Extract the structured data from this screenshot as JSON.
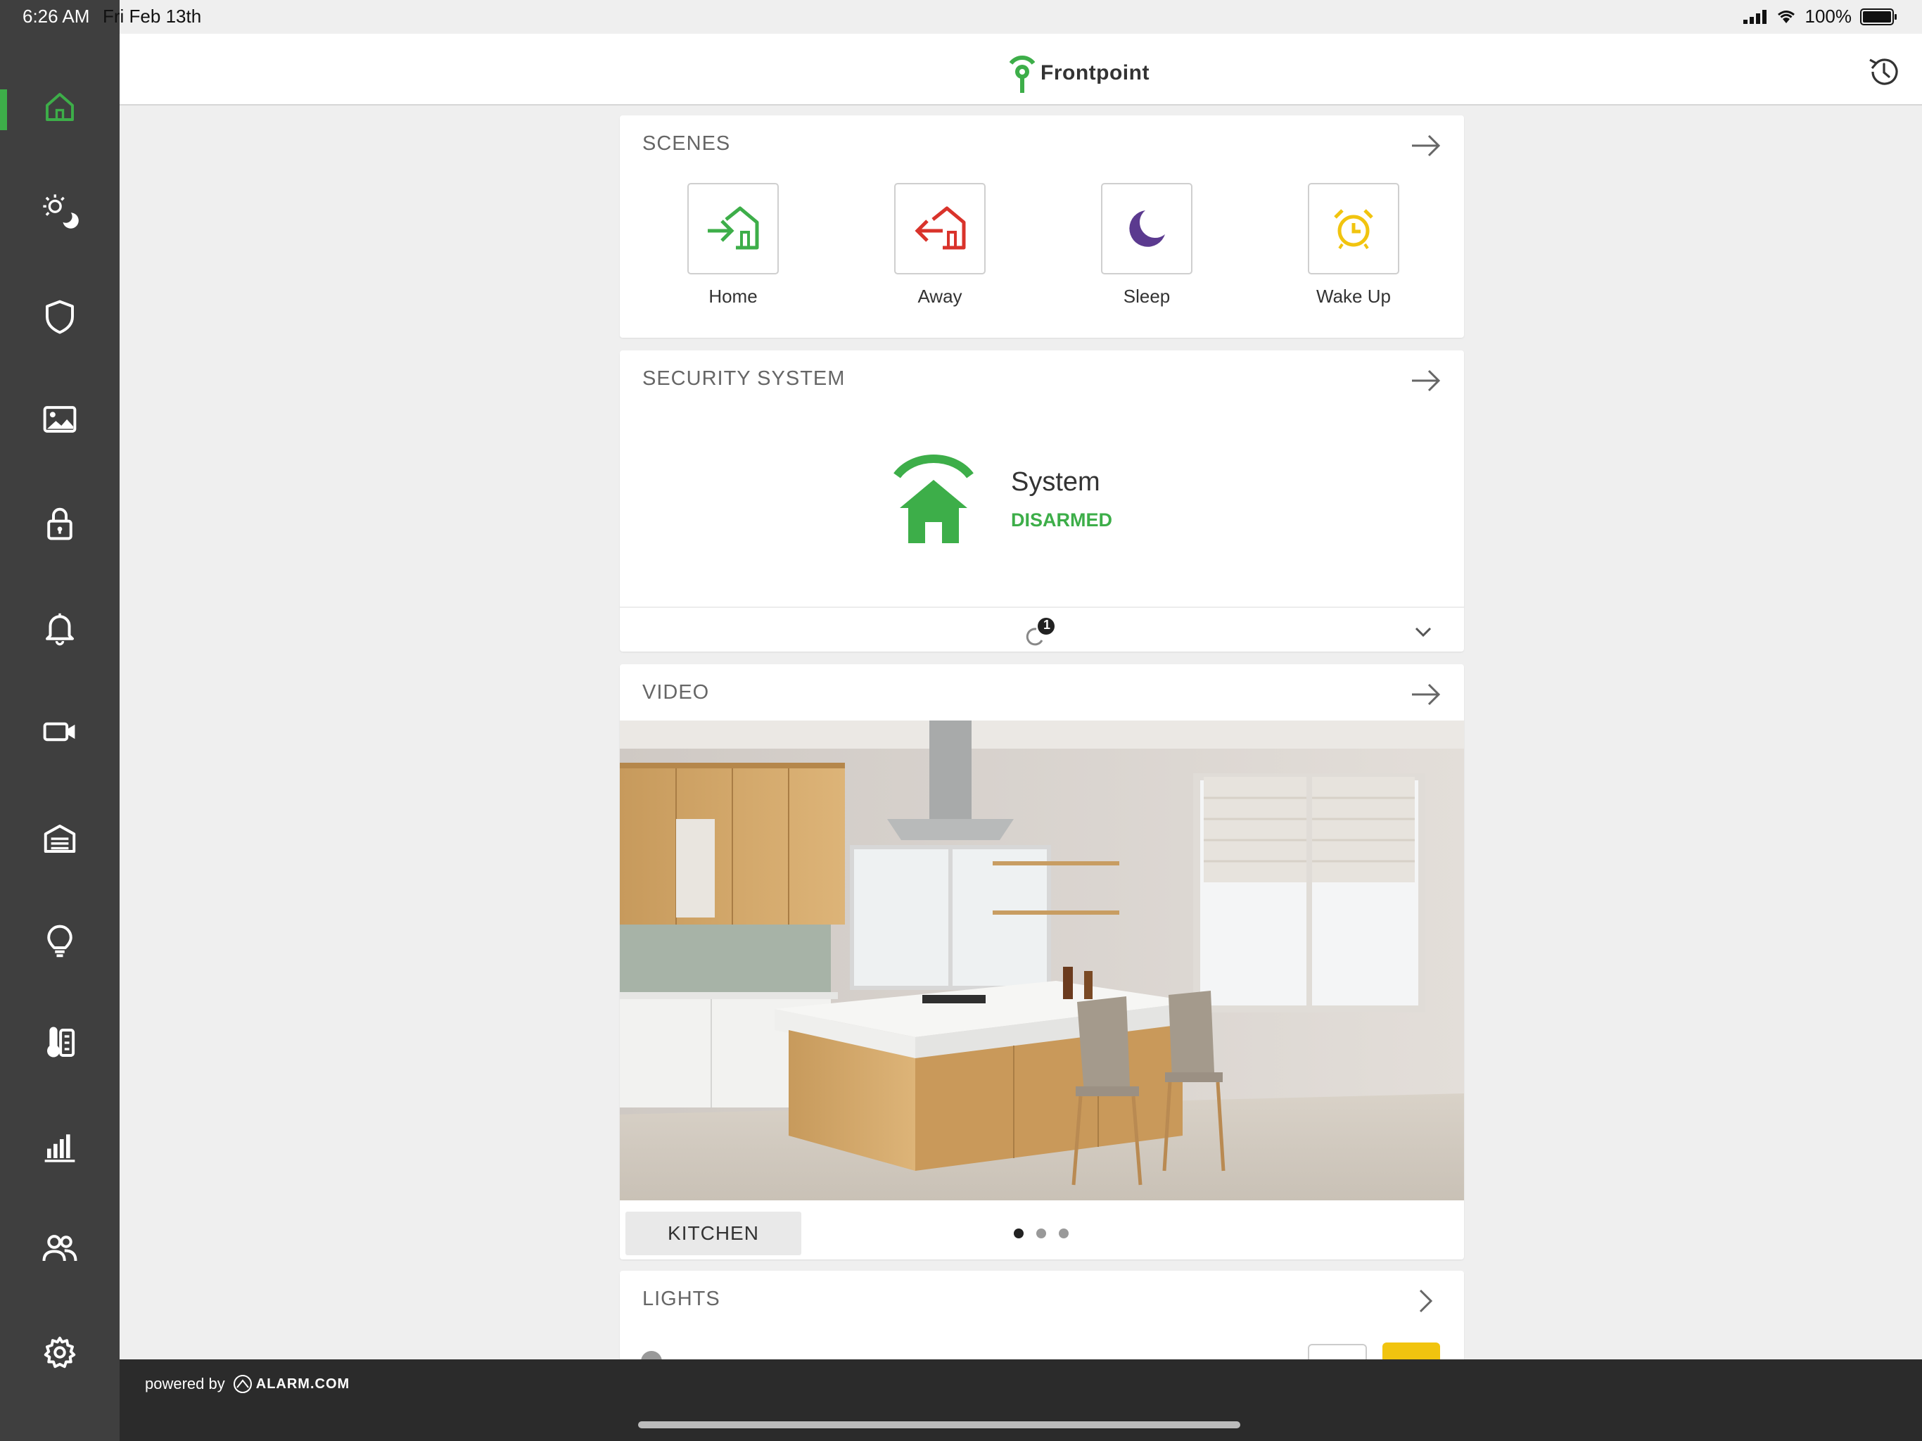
{
  "status_bar": {
    "time": "6:26 AM",
    "date": "Fri Feb 13th",
    "battery": "100%"
  },
  "header": {
    "brand": "Frontpoint"
  },
  "sidebar": {
    "items": [
      {
        "name": "home",
        "icon": "home-icon",
        "active": true
      },
      {
        "name": "scenes",
        "icon": "sun-moon-icon"
      },
      {
        "name": "security",
        "icon": "shield-icon"
      },
      {
        "name": "images",
        "icon": "image-icon"
      },
      {
        "name": "locks",
        "icon": "lock-icon"
      },
      {
        "name": "notifications",
        "icon": "bell-icon"
      },
      {
        "name": "video",
        "icon": "video-camera-icon"
      },
      {
        "name": "garage",
        "icon": "garage-icon"
      },
      {
        "name": "lights",
        "icon": "lightbulb-icon"
      },
      {
        "name": "thermostat",
        "icon": "thermometer-icon"
      },
      {
        "name": "reports",
        "icon": "bar-chart-icon"
      },
      {
        "name": "users",
        "icon": "users-icon"
      },
      {
        "name": "settings",
        "icon": "gear-icon"
      }
    ]
  },
  "scenes": {
    "title": "SCENES",
    "items": [
      {
        "label": "Home",
        "color": "#3dae49"
      },
      {
        "label": "Away",
        "color": "#d9332b"
      },
      {
        "label": "Sleep",
        "color": "#5b3a8f"
      },
      {
        "label": "Wake Up",
        "color": "#f1c40f"
      }
    ]
  },
  "security": {
    "title": "SECURITY SYSTEM",
    "system_label": "System",
    "status": "DISARMED",
    "status_color": "#3dae49",
    "sync_count": "1"
  },
  "video": {
    "title": "VIDEO",
    "camera_label": "KITCHEN",
    "page_count": 3,
    "active_page": 1
  },
  "lights": {
    "title": "LIGHTS"
  },
  "footer": {
    "powered_by": "powered by",
    "partner": "ALARM.COM"
  },
  "colors": {
    "accent": "#3dae49",
    "sidebar": "#3f3f3f",
    "footer": "#2b2b2b"
  }
}
